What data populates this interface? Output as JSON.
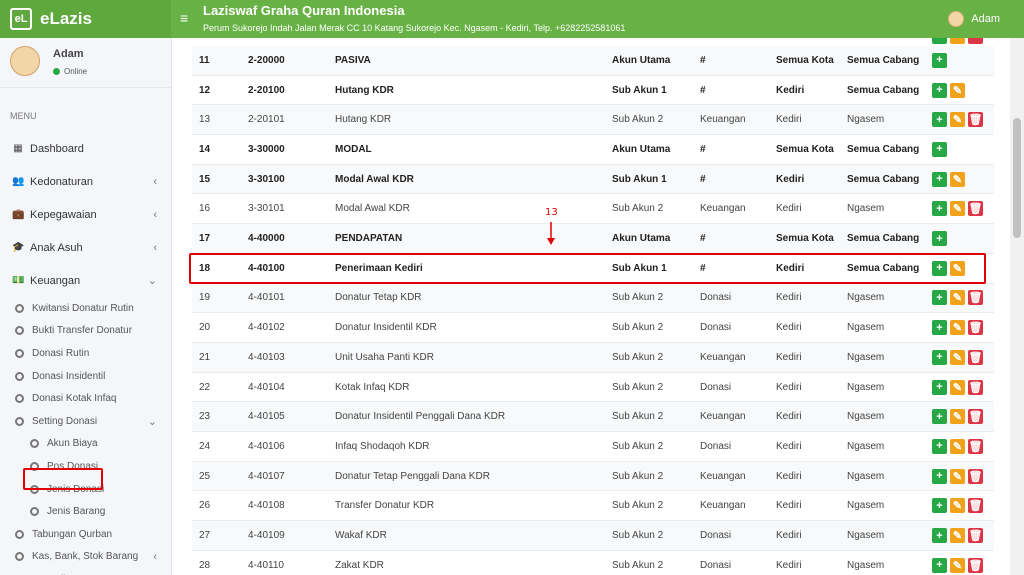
{
  "brand": {
    "name": "eLazis",
    "logo_text": "eL"
  },
  "header": {
    "title": "Laziswaf Graha Quran Indonesia",
    "address": "Perum Sukorejo Indah Jalan Merak CC 10 Katang Sukorejo Kec. Ngasem - Kediri, Telp. +6282252581061",
    "user": "Adam",
    "menu_icon": "≡"
  },
  "sidebar": {
    "user_name": "Adam",
    "status": "Online",
    "menu_header": "MENU",
    "items": [
      {
        "label": "Dashboard",
        "icon": "dashboard-icon",
        "glyph": "▦",
        "caret": ""
      },
      {
        "label": "Kedonaturan",
        "icon": "users-icon",
        "glyph": "👥",
        "caret": "‹"
      },
      {
        "label": "Kepegawaian",
        "icon": "briefcase-icon",
        "glyph": "💼",
        "caret": "‹"
      },
      {
        "label": "Anak Asuh",
        "icon": "graduation-cap-icon",
        "glyph": "🎓",
        "caret": "‹"
      },
      {
        "label": "Keuangan",
        "icon": "money-icon",
        "glyph": "💵",
        "caret": "⌄"
      }
    ],
    "keuangan_items": [
      "Kwitansi Donatur Rutin",
      "Bukti Transfer Donatur",
      "Donasi Rutin",
      "Donasi Insidentil",
      "Donasi Kotak Infaq",
      "Setting Donasi"
    ],
    "setting_items": [
      "Akun Biaya",
      "Pos Donasi",
      "Jenis Donasi",
      "Jenis Barang"
    ],
    "after_items": [
      {
        "label": "Tabungan Qurban",
        "caret": ""
      },
      {
        "label": "Kas, Bank, Stok Barang",
        "caret": "‹"
      },
      {
        "label": "Pengajian",
        "caret": ""
      }
    ]
  },
  "annotation": {
    "number": "13"
  },
  "table": {
    "rows": [
      {
        "no": "11",
        "code": "2-20000",
        "name": "PASIVA",
        "type": "Akun Utama",
        "category": "#",
        "city": "Semua Kota",
        "branch": "Semua Cabang",
        "bold": true,
        "actions": [
          "add"
        ]
      },
      {
        "no": "12",
        "code": "2-20100",
        "name": "Hutang KDR",
        "type": "Sub Akun 1",
        "category": "#",
        "city": "Kediri",
        "branch": "Semua Cabang",
        "bold": true,
        "actions": [
          "add",
          "edit"
        ]
      },
      {
        "no": "13",
        "code": "2-20101",
        "name": "Hutang KDR",
        "type": "Sub Akun 2",
        "category": "Keuangan",
        "city": "Kediri",
        "branch": "Ngasem",
        "bold": false,
        "actions": [
          "add",
          "edit",
          "delete"
        ]
      },
      {
        "no": "14",
        "code": "3-30000",
        "name": "MODAL",
        "type": "Akun Utama",
        "category": "#",
        "city": "Semua Kota",
        "branch": "Semua Cabang",
        "bold": true,
        "actions": [
          "add"
        ]
      },
      {
        "no": "15",
        "code": "3-30100",
        "name": "Modal Awal KDR",
        "type": "Sub Akun 1",
        "category": "#",
        "city": "Kediri",
        "branch": "Semua Cabang",
        "bold": true,
        "actions": [
          "add",
          "edit"
        ]
      },
      {
        "no": "16",
        "code": "3-30101",
        "name": "Modal Awal KDR",
        "type": "Sub Akun 2",
        "category": "Keuangan",
        "city": "Kediri",
        "branch": "Ngasem",
        "bold": false,
        "actions": [
          "add",
          "edit",
          "delete"
        ]
      },
      {
        "no": "17",
        "code": "4-40000",
        "name": "PENDAPATAN",
        "type": "Akun Utama",
        "category": "#",
        "city": "Semua Kota",
        "branch": "Semua Cabang",
        "bold": true,
        "actions": [
          "add"
        ]
      },
      {
        "no": "18",
        "code": "4-40100",
        "name": "Penerimaan Kediri",
        "type": "Sub Akun 1",
        "category": "#",
        "city": "Kediri",
        "branch": "Semua Cabang",
        "bold": true,
        "actions": [
          "add",
          "edit"
        ]
      },
      {
        "no": "19",
        "code": "4-40101",
        "name": "Donatur Tetap KDR",
        "type": "Sub Akun 2",
        "category": "Donasi",
        "city": "Kediri",
        "branch": "Ngasem",
        "bold": false,
        "actions": [
          "add",
          "edit",
          "delete"
        ]
      },
      {
        "no": "20",
        "code": "4-40102",
        "name": "Donatur Insidentil KDR",
        "type": "Sub Akun 2",
        "category": "Donasi",
        "city": "Kediri",
        "branch": "Ngasem",
        "bold": false,
        "actions": [
          "add",
          "edit",
          "delete"
        ]
      },
      {
        "no": "21",
        "code": "4-40103",
        "name": "Unit Usaha Panti KDR",
        "type": "Sub Akun 2",
        "category": "Keuangan",
        "city": "Kediri",
        "branch": "Ngasem",
        "bold": false,
        "actions": [
          "add",
          "edit",
          "delete"
        ]
      },
      {
        "no": "22",
        "code": "4-40104",
        "name": "Kotak Infaq KDR",
        "type": "Sub Akun 2",
        "category": "Donasi",
        "city": "Kediri",
        "branch": "Ngasem",
        "bold": false,
        "actions": [
          "add",
          "edit",
          "delete"
        ]
      },
      {
        "no": "23",
        "code": "4-40105",
        "name": "Donatur Insidentil Penggali Dana KDR",
        "type": "Sub Akun 2",
        "category": "Keuangan",
        "city": "Kediri",
        "branch": "Ngasem",
        "bold": false,
        "actions": [
          "add",
          "edit",
          "delete"
        ]
      },
      {
        "no": "24",
        "code": "4-40106",
        "name": "Infaq Shodaqoh KDR",
        "type": "Sub Akun 2",
        "category": "Donasi",
        "city": "Kediri",
        "branch": "Ngasem",
        "bold": false,
        "actions": [
          "add",
          "edit",
          "delete"
        ]
      },
      {
        "no": "25",
        "code": "4-40107",
        "name": "Donatur Tetap Penggali Dana KDR",
        "type": "Sub Akun 2",
        "category": "Keuangan",
        "city": "Kediri",
        "branch": "Ngasem",
        "bold": false,
        "actions": [
          "add",
          "edit",
          "delete"
        ]
      },
      {
        "no": "26",
        "code": "4-40108",
        "name": "Transfer Donatur KDR",
        "type": "Sub Akun 2",
        "category": "Keuangan",
        "city": "Kediri",
        "branch": "Ngasem",
        "bold": false,
        "actions": [
          "add",
          "edit",
          "delete"
        ]
      },
      {
        "no": "27",
        "code": "4-40109",
        "name": "Wakaf KDR",
        "type": "Sub Akun 2",
        "category": "Donasi",
        "city": "Kediri",
        "branch": "Ngasem",
        "bold": false,
        "actions": [
          "add",
          "edit",
          "delete"
        ]
      },
      {
        "no": "28",
        "code": "4-40110",
        "name": "Zakat KDR",
        "type": "Sub Akun 2",
        "category": "Donasi",
        "city": "Kediri",
        "branch": "Ngasem",
        "bold": false,
        "actions": [
          "add",
          "edit",
          "delete"
        ]
      }
    ],
    "action_glyphs": {
      "add": "+",
      "edit": "✎",
      "delete": "🗑"
    }
  },
  "colors": {
    "header_green": "#68b245",
    "add": "#28a745",
    "edit": "#f0a21b",
    "delete": "#dc3545",
    "annotation_red": "#e30000"
  }
}
